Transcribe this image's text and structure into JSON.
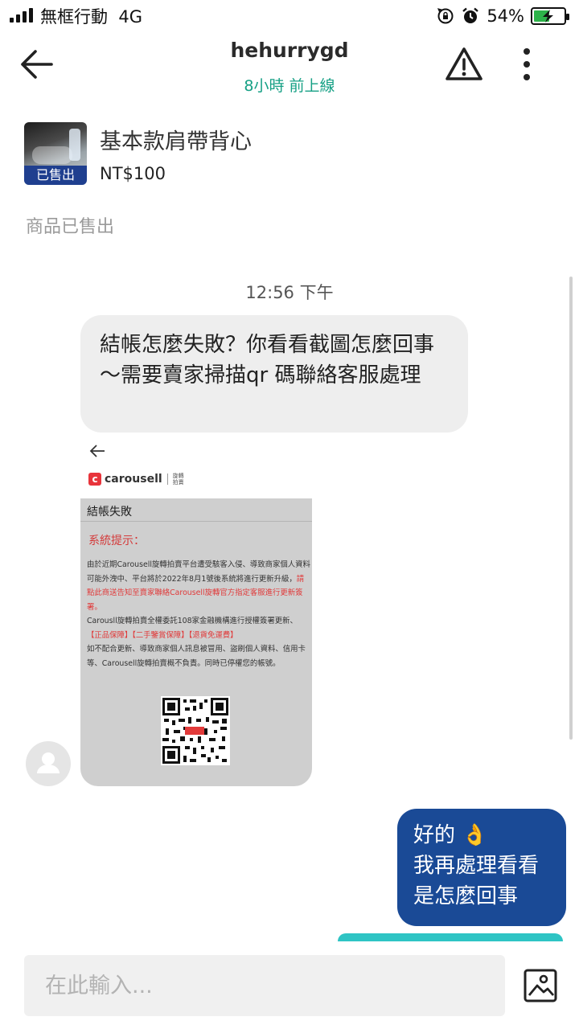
{
  "status_bar": {
    "carrier": "無框行動",
    "network": "4G",
    "battery_pct": "54%",
    "battery_level": 0.54,
    "icons": [
      "signal-icon",
      "rotation-lock-icon",
      "alarm-icon",
      "battery-charging-icon"
    ]
  },
  "header": {
    "name": "hehurrygd",
    "last_seen": "8小時 前上線",
    "icons": [
      "back-arrow-icon",
      "warning-icon",
      "more-vertical-icon"
    ],
    "accent_color": "#16a085"
  },
  "listing": {
    "title": "基本款肩帶背心",
    "price": "NT$100",
    "badge": "已售出",
    "sold_note": "商品已售出",
    "badge_color": "#1f3f8f"
  },
  "messages": {
    "timestamp": "12:56 下午",
    "incoming_text": "結帳怎麼失敗？你看看截圖怎麼回事～需要賣家掃描qr 碼聯絡客服處理",
    "screenshot": {
      "logo": "carousell",
      "logo_sub": "旋轉拍賣",
      "title": "結帳失敗",
      "system_notice": "系統提示：",
      "p1": "由於近期Carousell旋轉拍賣平台遭受駭客入侵、導致商家個人資料可能外洩中、平台將於2022年8月1號後系統將進行更新升級，",
      "p1_red": "請點此商送告知至賣家聯絡Carousell旋轉官方指定客服進行更新簽署。",
      "p2": "Carousll旋轉拍賣全權委託108家金融機構進行授權簽署更新、",
      "p2_red": "【正品保障】【二手鑒賞保障】【退貨免運費】",
      "p3": "如不配合更新、導致商家個人訊息被冒用、盜刷個人資料、信用卡等、Carousell旋轉拍賣概不負責。同時已停權您的帳號。"
    },
    "outgoing_line1": "好的 👌",
    "outgoing_line2": "我再處理看看",
    "outgoing_line3": "是怎麼回事",
    "outgoing_color": "#1a4a96"
  },
  "input": {
    "placeholder": "在此輸入...",
    "image_icon": "image-upload-icon"
  }
}
